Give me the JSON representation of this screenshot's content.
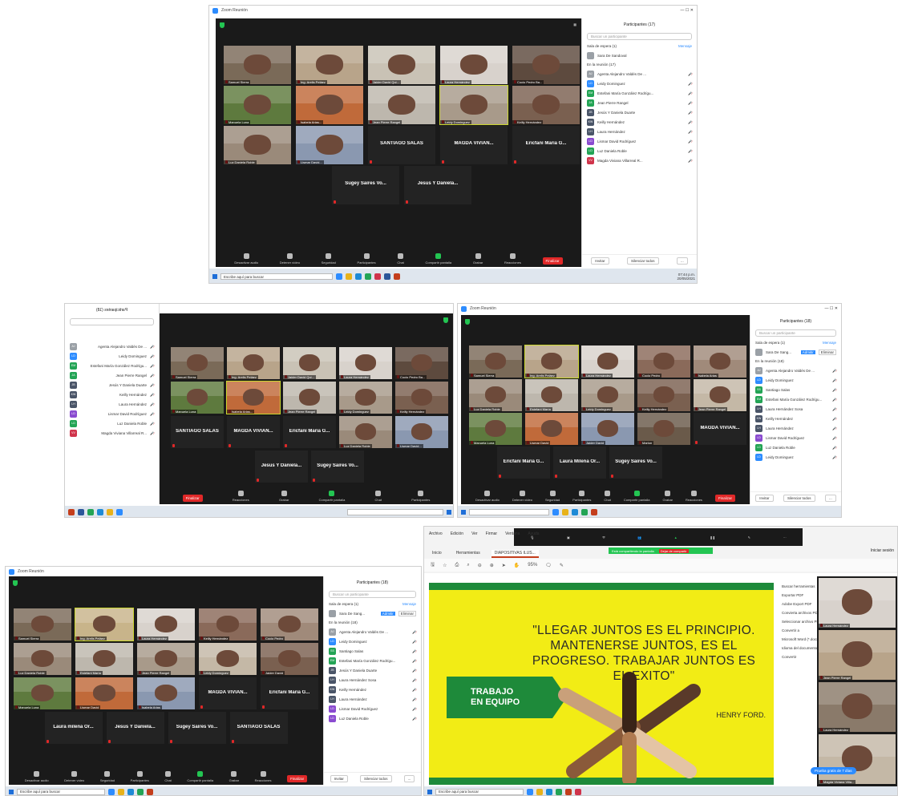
{
  "shot1": {
    "title": "Zoom Reunión",
    "panel_title": "Participantes (17)",
    "search_placeholder": "Buscar un participante",
    "waiting_label": "Sala de espera (1)",
    "message_label": "Mensaje",
    "waiting_person": "Sara De Sandoval",
    "meeting_label": "En la reunión (17)",
    "participants": [
      {
        "initials": "AJ",
        "name": "Agenta Alejandro Valdés De ...",
        "color": "#9aa0a6"
      },
      {
        "initials": "LD",
        "name": "Leidy Dominguez",
        "color": "#2d8cff"
      },
      {
        "initials": "EM",
        "name": "Estefani María González Rodrígu...",
        "color": "#23a455"
      },
      {
        "initials": "JA",
        "name": "Jean Pierre Rangel",
        "color": "#23a455"
      },
      {
        "initials": "JB",
        "name": "Jesús Y Daniela Duarte",
        "color": "#4a5568"
      },
      {
        "initials": "KW",
        "name": "Keilly Hernández",
        "color": "#4a5568"
      },
      {
        "initials": "LH",
        "name": "Laura Hernández",
        "color": "#4a5568"
      },
      {
        "initials": "LD",
        "name": "Lismar David Rodríguez",
        "color": "#8a4bd0"
      },
      {
        "initials": "LD",
        "name": "Luz Daniela Roble",
        "color": "#23a455"
      },
      {
        "initials": "VV",
        "name": "Magda Viviana Villarreal R...",
        "color": "#d0344b"
      }
    ],
    "footer": [
      "Invitar",
      "Silenciar todos",
      "..."
    ],
    "tiles": [
      {
        "name": "Samuel Sierra",
        "bg": "#7a6a58"
      },
      {
        "name": "Ing. Arelis Peláez",
        "bg": "#b8a48a"
      },
      {
        "name": "Jaider David Qui...",
        "bg": "#c9c2b5"
      },
      {
        "name": "Laura Hernández",
        "bg": "#d8d2cc"
      },
      {
        "name": "Cocio Pedro Ba...",
        "bg": "#5d4a3e"
      },
      {
        "name": "Manuela Luna",
        "bg": "#5e7a3e"
      },
      {
        "name": "Isabela Arias...",
        "bg": "#c06a3a"
      },
      {
        "name": "Jean Pierre Rangel",
        "bg": "#bdb7ad"
      },
      {
        "name": "Leidy Dominguez",
        "bg": "#a89a8a"
      },
      {
        "name": "Keilly Hernández",
        "bg": "#7a6050"
      },
      {
        "name": "Luz Daniela Roble",
        "bg": "#9a8a7a"
      },
      {
        "name": "Lismar David...",
        "bg": "#8a98b0"
      }
    ],
    "name_tiles": [
      "SANTIAGO SALAS",
      "MAGDA VIVIAN...",
      "Ericfani Maria G...",
      "Sugey Saires Vo...",
      "Jesus Y Daniela..."
    ],
    "controls": [
      "Desactivar audio",
      "Detener vídeo",
      "Seguridad",
      "Participantes",
      "Chat",
      "Compartir pantalla",
      "Grabar",
      "Reacciones"
    ],
    "end_label": "Finalizar",
    "search_bar": "Escribe aquí para buscar",
    "time": "07:44 p.m.",
    "date": "20/05/2021"
  },
  "shot2": {
    "panel_title": "Participantes (18)",
    "name_tiles": [
      "SANTIAGO SALAS",
      "MAGDA VIVIAN...",
      "Ericfani Maria G...",
      "Jesus Y Daniela...",
      "Sugey Saires Vo..."
    ],
    "controls": [
      "Participantes",
      "Chat",
      "Compartir pantalla",
      "Grabar",
      "Reacciones"
    ],
    "end_label": "Finalizar"
  },
  "shot3": {
    "title": "Zoom Reunión",
    "panel_title": "Participantes (18)",
    "search_placeholder": "Buscar un participante",
    "waiting_label": "Sala de espera (1)",
    "message_label": "Mensaje",
    "waiting_person": "Sara De Sang...",
    "admit": "Admitir",
    "remove": "Eliminar",
    "meeting_label": "En la reunión (18)",
    "participants": [
      {
        "initials": "AJ",
        "name": "Agenta Alejandro Valdés De ...",
        "color": "#9aa0a6"
      },
      {
        "initials": "LD",
        "name": "Leidy Dominguez",
        "color": "#2d8cff"
      },
      {
        "initials": "SS",
        "name": "Santiago Salas",
        "color": "#23a455"
      },
      {
        "initials": "EM",
        "name": "Estefani María González Rodrígu...",
        "color": "#23a455"
      },
      {
        "initials": "LH",
        "name": "Laura Hernández Sosa",
        "color": "#4a5568"
      },
      {
        "initials": "KW",
        "name": "Keilly Hernández",
        "color": "#4a5568"
      },
      {
        "initials": "LH",
        "name": "Laura Hernández",
        "color": "#4a5568"
      },
      {
        "initials": "LD",
        "name": "Lismar David Rodríguez",
        "color": "#8a4bd0"
      },
      {
        "initials": "LD",
        "name": "Luz Daniela Roble",
        "color": "#23a455"
      },
      {
        "initials": "LD",
        "name": "Leidy Dominguez",
        "color": "#2d8cff"
      }
    ],
    "footer": [
      "Invitar",
      "Silenciar todos",
      "..."
    ],
    "tiles": [
      {
        "name": "Samuel Sierra",
        "bg": "#7a6a58"
      },
      {
        "name": "Ing. Arelis Peláez",
        "bg": "#b8a48a"
      },
      {
        "name": "Laura Hernández",
        "bg": "#d8d2cc"
      },
      {
        "name": "Cocio Pedro",
        "bg": "#8a6a5a"
      },
      {
        "name": "Isabela Arias",
        "bg": "#a08a7a"
      },
      {
        "name": "Luz Daniela Roble",
        "bg": "#9a8a7a"
      },
      {
        "name": "Estefani María",
        "bg": "#bdb7ad"
      },
      {
        "name": "Leidy Dominguez",
        "bg": "#a89a8a"
      },
      {
        "name": "Keilly Hernández",
        "bg": "#7a6050"
      },
      {
        "name": "Jean Pierre Rangel",
        "bg": "#c4b8a6"
      },
      {
        "name": "Manuela Luna",
        "bg": "#5e7a3e"
      },
      {
        "name": "Lismar David",
        "bg": "#c06a3a"
      },
      {
        "name": "Jaider David",
        "bg": "#8a98b0"
      },
      {
        "name": "Marlon",
        "bg": "#6a5a4a"
      }
    ],
    "name_tiles": [
      "MAGDA VIVIAN...",
      "Ericfani Maria G...",
      "Laura Milena Or...",
      "Sugey Saires Vo..."
    ],
    "controls": [
      "Desactivar audio",
      "Detener vídeo",
      "Seguridad",
      "Participantes",
      "Chat",
      "Compartir pantalla",
      "Grabar",
      "Reacciones"
    ],
    "end_label": "Finalizar"
  },
  "shot4": {
    "title": "Zoom Reunión",
    "panel_title": "Participantes (18)",
    "search_placeholder": "Buscar un participante",
    "waiting_label": "Sala de espera (1)",
    "message_label": "Mensaje",
    "waiting_person": "Sara De Sang...",
    "admit": "Admitir",
    "remove": "Eliminar",
    "meeting_label": "En la reunión (18)",
    "participants": [
      {
        "initials": "AJ",
        "name": "Agenta Alejandro Valdés De ...",
        "color": "#9aa0a6"
      },
      {
        "initials": "LD",
        "name": "Leidy Dominguez",
        "color": "#2d8cff"
      },
      {
        "initials": "SS",
        "name": "Santiago Salas",
        "color": "#23a455"
      },
      {
        "initials": "EM",
        "name": "Estefani María González Rodrígu...",
        "color": "#23a455"
      },
      {
        "initials": "JB",
        "name": "Jesús Y Daniela Duarte",
        "color": "#4a5568"
      },
      {
        "initials": "LH",
        "name": "Laura Hernández Sosa",
        "color": "#4a5568"
      },
      {
        "initials": "KW",
        "name": "Keilly Hernández",
        "color": "#4a5568"
      },
      {
        "initials": "LH",
        "name": "Laura Hernández",
        "color": "#4a5568"
      },
      {
        "initials": "LD",
        "name": "Lismar David Rodríguez",
        "color": "#8a4bd0"
      },
      {
        "initials": "LD",
        "name": "Luz Daniela Roble",
        "color": "#8a4bd0"
      }
    ],
    "footer": [
      "Invitar",
      "Silenciar todos",
      "..."
    ],
    "tiles": [
      {
        "name": "Samuel Sierra",
        "bg": "#7a6a58"
      },
      {
        "name": "Ing. Arelis Peláez",
        "bg": "#c8b48a"
      },
      {
        "name": "Laura Hernández",
        "bg": "#d8d2cc"
      },
      {
        "name": "Keilly Hernández",
        "bg": "#8a6a5a"
      },
      {
        "name": "Cocio Pedro",
        "bg": "#a08a7a"
      },
      {
        "name": "Luz Daniela Roble",
        "bg": "#9a8a7a"
      },
      {
        "name": "Estefani María",
        "bg": "#bdb7ad"
      },
      {
        "name": "Jean Pierre Rangel",
        "bg": "#a89a8a"
      },
      {
        "name": "Leidy Dominguez",
        "bg": "#c4b8a6"
      },
      {
        "name": "Jaider David",
        "bg": "#7a6050"
      },
      {
        "name": "Manuela Luna",
        "bg": "#5e7a3e"
      },
      {
        "name": "Lismar David",
        "bg": "#c06a3a"
      },
      {
        "name": "Isabela Arias",
        "bg": "#8a98b0"
      }
    ],
    "name_tiles": [
      "MAGDA VIVIAN...",
      "Ericfani Maria G...",
      "Laura milena Or...",
      "Jesus Y Daniela...",
      "Sugey Saires Vo...",
      "SANTIAGO SALAS"
    ],
    "controls": [
      "Desactivar audio",
      "Detener vídeo",
      "Seguridad",
      "Participantes",
      "Chat",
      "Compartir pantalla",
      "Grabar",
      "Reacciones"
    ],
    "end_label": "Finalizar",
    "search_bar": "Escribe aquí para buscar"
  },
  "shot5": {
    "share_bar": "Está compartiendo la pantalla",
    "stop_share": "Dejar de compartir",
    "tabs": [
      "Inicio",
      "Herramientas",
      "DIAPOSITIVAS ILUS..."
    ],
    "menu": [
      "Archivo",
      "Edición",
      "Ver",
      "Firmar",
      "Ventana",
      "Ayuda"
    ],
    "signin": "Iniciar sesión",
    "zoom_level": "95%",
    "quote": "\"LLEGAR JUNTOS ES EL PRINCIPIO. MANTENERSE JUNTOS, ES EL PROGRESO. TRABAJAR JUNTOS ES EL EXITO\"",
    "tag_line1": "TRABAJO",
    "tag_line2": "EN EQUIPO",
    "author": "HENRY FORD.",
    "side_items": [
      "Buscar herramientas",
      "Exportar PDF",
      "Adobe Export PDF",
      "Convierta archivos PDF a Word o Excel en línea",
      "Seleccionar archivo PDF",
      "Convertir a",
      "Microsoft Word (*.docx)",
      "Idioma del documento: Español",
      "Convertir"
    ],
    "share_btn": "Prueba gratis de 7 días",
    "side_tiles": [
      {
        "name": "Laura Hernández",
        "bg": "#d8d2cc"
      },
      {
        "name": "Jean Pierre Rangel",
        "bg": "#b8a48a"
      },
      {
        "name": "Laura Hernández",
        "bg": "#8a7a6a"
      },
      {
        "name": "Magda Viviana Villa...",
        "bg": "#c4b8a6"
      }
    ],
    "search_bar": "Escribe aquí para buscar"
  }
}
